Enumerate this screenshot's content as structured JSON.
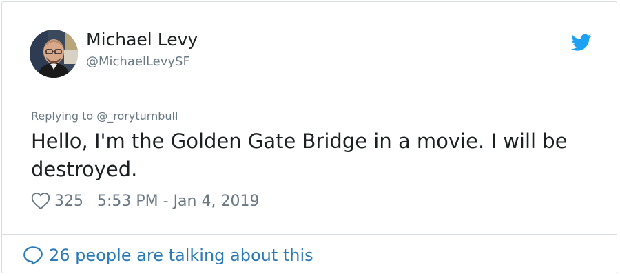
{
  "tweet": {
    "author": {
      "name": "Michael Levy",
      "handle": "@MichaelLevySF"
    },
    "reply_context": "Replying to @_roryturnbull",
    "text": "Hello, I'm the Golden Gate Bridge in a movie. I will be destroyed.",
    "likes": "325",
    "timestamp": "5:53 PM - Jan 4, 2019",
    "talking": "26 people are talking about this"
  },
  "icons": {
    "brand": "twitter-bird-icon",
    "like": "heart-outline-icon",
    "reply": "speech-bubble-icon"
  },
  "colors": {
    "brand_blue": "#1da1f2",
    "link_blue": "#2b7bb9",
    "muted_gray": "#697882",
    "text": "#1c2022"
  }
}
